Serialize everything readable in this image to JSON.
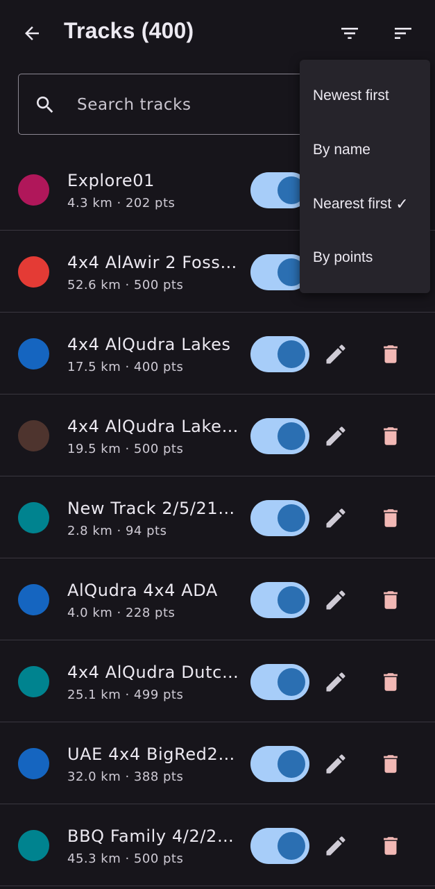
{
  "header": {
    "title": "Tracks (400)",
    "icons": [
      "arrow-back-icon",
      "filter-icon",
      "sort-icon"
    ]
  },
  "search": {
    "placeholder": "Search tracks",
    "value": ""
  },
  "sort_menu": {
    "items": [
      {
        "label": "Newest first",
        "selected": false
      },
      {
        "label": "By name",
        "selected": false
      },
      {
        "label": "Nearest first",
        "selected": true
      },
      {
        "label": "By points",
        "selected": false
      }
    ],
    "check_mark": "✓"
  },
  "tracks": [
    {
      "name": "Explore01",
      "meta": "4.3 km · 202 pts",
      "color": "#b0175a",
      "visible": true
    },
    {
      "name": "4x4 AlAwir 2 Foss…",
      "meta": "52.6 km · 500 pts",
      "color": "#e43b35",
      "visible": true
    },
    {
      "name": "4x4 AlQudra Lakes",
      "meta": "17.5 km · 400 pts",
      "color": "#1565c0",
      "visible": true
    },
    {
      "name": "4x4 AlQudra Lake…",
      "meta": "19.5 km · 500 pts",
      "color": "#4e342e",
      "visible": true
    },
    {
      "name": "New Track 2/5/21…",
      "meta": "2.8 km · 94 pts",
      "color": "#00838f",
      "visible": true
    },
    {
      "name": "AlQudra 4x4 ADA",
      "meta": "4.0 km · 228 pts",
      "color": "#1565c0",
      "visible": true
    },
    {
      "name": "4x4 AlQudra Dutc…",
      "meta": "25.1 km · 499 pts",
      "color": "#00838f",
      "visible": true
    },
    {
      "name": "UAE 4x4 BigRed2…",
      "meta": "32.0 km · 388 pts",
      "color": "#1565c0",
      "visible": true
    },
    {
      "name": "BBQ Family 4/2/2…",
      "meta": "45.3 km · 500 pts",
      "color": "#00838f",
      "visible": true
    }
  ],
  "colors": {
    "background": "#17151b",
    "toggle_track": "#a7cdf9",
    "toggle_knob": "#2b6fb2",
    "delete_icon": "#f2b8b5",
    "edit_icon": "#cfcbd5"
  }
}
